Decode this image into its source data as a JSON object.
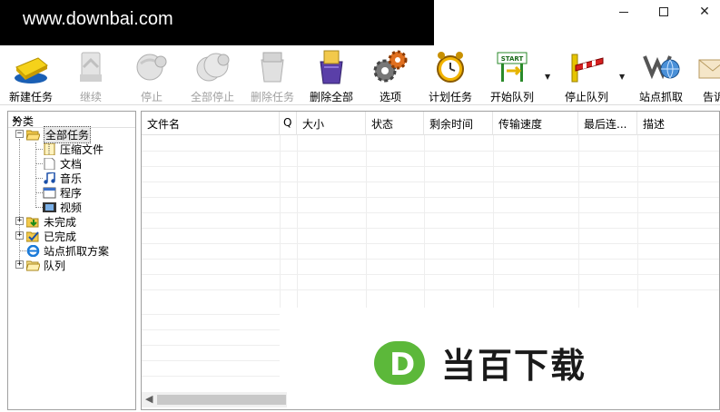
{
  "titlebar": {
    "banner_text": "www.downbai.com",
    "min_glyph": "—",
    "close_glyph": "✕"
  },
  "toolbar": {
    "items": [
      {
        "label": "新建任务",
        "icon": "new-task-icon",
        "enabled": true
      },
      {
        "label": "继续",
        "icon": "resume-icon",
        "enabled": false
      },
      {
        "label": "停止",
        "icon": "stop-icon",
        "enabled": false
      },
      {
        "label": "全部停止",
        "icon": "stop-all-icon",
        "enabled": false
      },
      {
        "label": "删除任务",
        "icon": "delete-task-icon",
        "enabled": false
      },
      {
        "label": "删除全部",
        "icon": "delete-all-icon",
        "enabled": true
      },
      {
        "label": "选项",
        "icon": "gear-icon",
        "enabled": true
      },
      {
        "label": "计划任务",
        "icon": "alarm-clock-icon",
        "enabled": true
      },
      {
        "label": "开始队列",
        "icon": "start-queue-icon",
        "enabled": true,
        "start_sign": "START"
      },
      {
        "label": "停止队列",
        "icon": "stop-queue-icon",
        "enabled": true
      },
      {
        "label": "站点抓取",
        "icon": "site-grabber-icon",
        "enabled": true
      },
      {
        "label": "告诉",
        "icon": "tell-friend-icon",
        "enabled": true
      }
    ]
  },
  "sidebar": {
    "header": "分类",
    "close": "✕",
    "tree": [
      {
        "label": "全部任务",
        "icon": "folder-open-icon"
      },
      {
        "label": "压缩文件",
        "icon": "zip-file-icon"
      },
      {
        "label": "文档",
        "icon": "document-icon"
      },
      {
        "label": "音乐",
        "icon": "music-icon"
      },
      {
        "label": "程序",
        "icon": "program-icon"
      },
      {
        "label": "视频",
        "icon": "video-icon"
      },
      {
        "label": "未完成",
        "icon": "unfinished-folder-icon"
      },
      {
        "label": "已完成",
        "icon": "finished-folder-icon"
      },
      {
        "label": "站点抓取方案",
        "icon": "ie-icon"
      },
      {
        "label": "队列",
        "icon": "queue-folder-icon"
      }
    ]
  },
  "table": {
    "columns": [
      "文件名",
      "Q",
      "大小",
      "状态",
      "剩余时间",
      "传输速度",
      "最后连...",
      "描述"
    ]
  },
  "watermark": {
    "logo_letter": "D",
    "text": "当百下载"
  },
  "colors": {
    "logo_green": "#5cb83a",
    "folder_yellow": "#f2c94c"
  }
}
